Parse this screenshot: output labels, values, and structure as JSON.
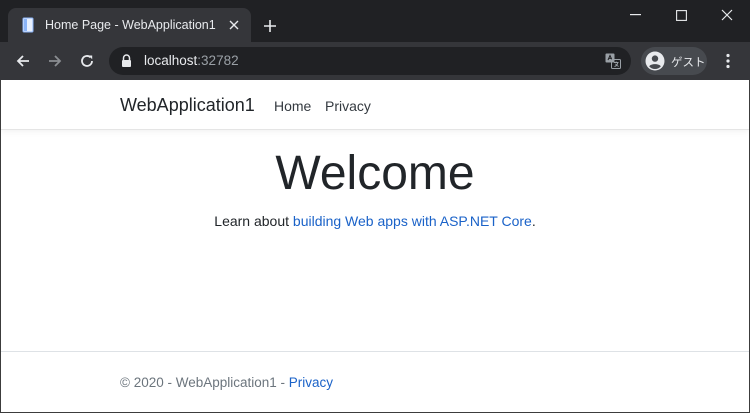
{
  "browser": {
    "tab_title": "Home Page - WebApplication1",
    "url_host": "localhost",
    "url_port": ":32782",
    "profile_label": "ゲスト"
  },
  "site": {
    "brand": "WebApplication1",
    "nav": [
      "Home",
      "Privacy"
    ],
    "heading": "Welcome",
    "intro_prefix": "Learn about ",
    "intro_link": "building Web apps with ASP.NET Core",
    "intro_suffix": ".",
    "footer_text": "© 2020 - WebApplication1 - ",
    "footer_link": "Privacy"
  }
}
